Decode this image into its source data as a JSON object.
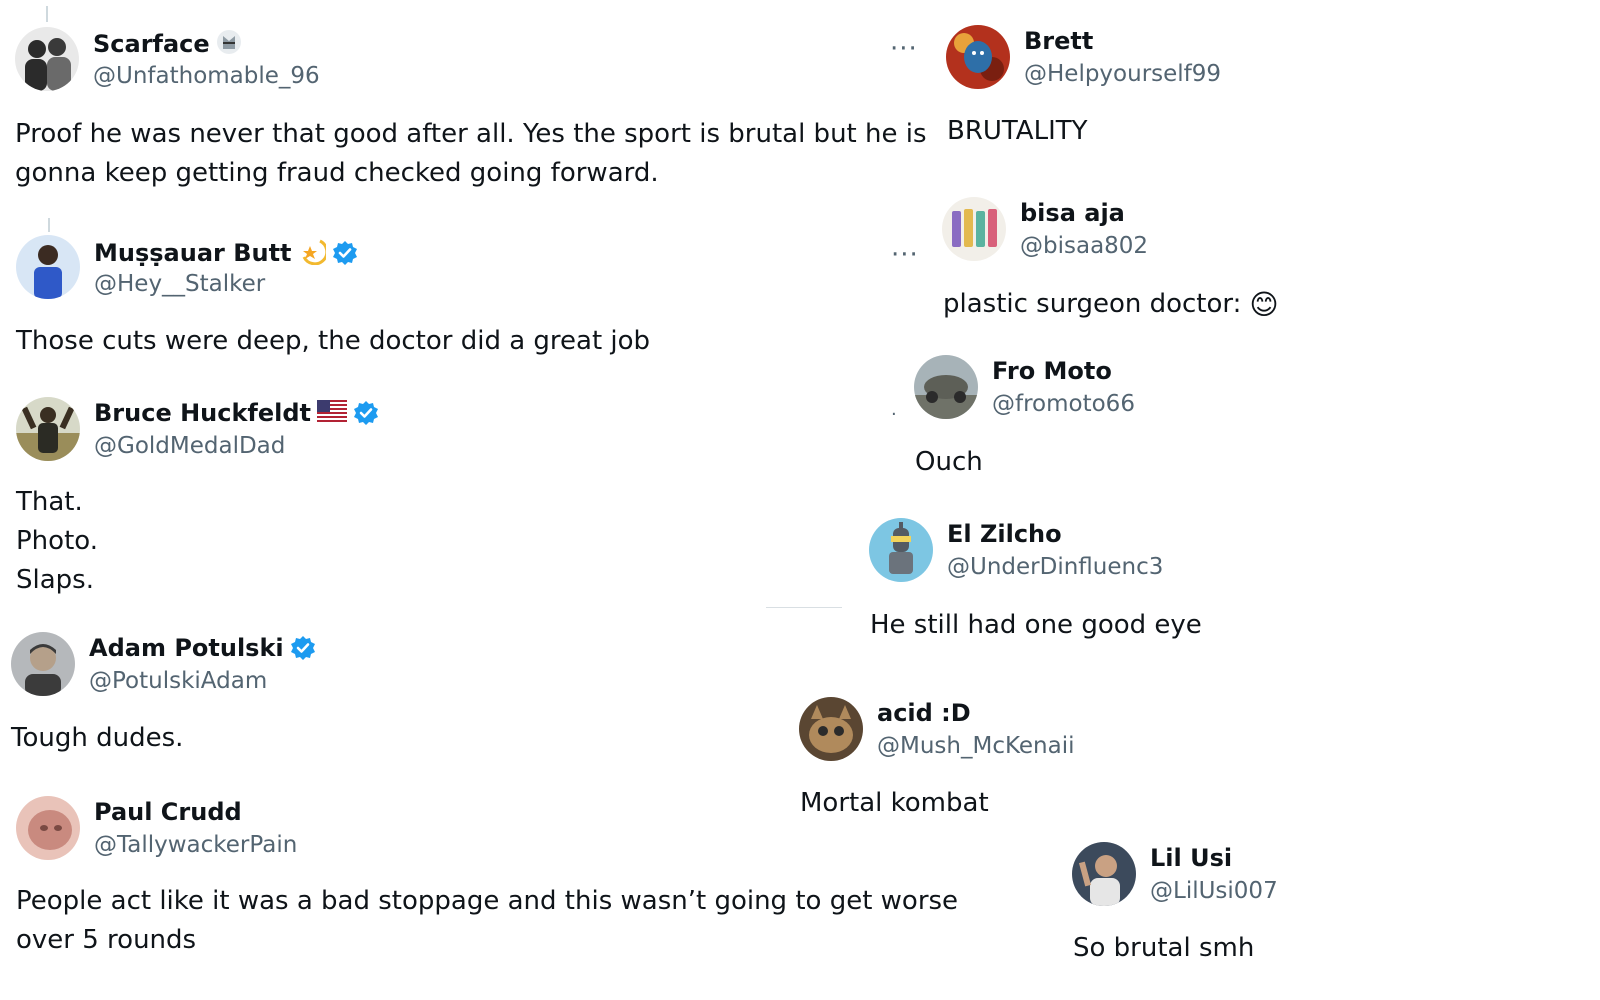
{
  "replies_left": [
    {
      "name": "Scarface",
      "handle": "@Unfathomable_96",
      "lines": [
        "Proof he was never that good after all. Yes the sport is brutal but he is",
        "gonna keep getting fraud checked going forward."
      ],
      "avatar_colors": [
        "#2b2b2b",
        "#6a6a6a"
      ]
    },
    {
      "name": "Muṣṣauar Butt",
      "handle": "@Hey__Stalker",
      "lines": [
        "Those cuts were deep, the doctor did a great job"
      ],
      "avatar_colors": [
        "#2f59c8",
        "#d8e6f5"
      ]
    },
    {
      "name": "Bruce Huckfeldt",
      "handle": "@GoldMedalDad",
      "lines": [
        "That.",
        "Photo.",
        "Slaps."
      ],
      "avatar_colors": [
        "#9a8d5a",
        "#e3e3d8"
      ]
    },
    {
      "name": "Adam Potulski",
      "handle": "@PotulskiAdam",
      "lines": [
        "Tough dudes."
      ],
      "avatar_colors": [
        "#3b3b3b",
        "#b5a08a"
      ]
    },
    {
      "name": "Paul Crudd",
      "handle": "@TallywackerPain",
      "lines": [
        "People act like it was a bad stoppage and this wasn’t going to get worse",
        "over 5 rounds"
      ],
      "avatar_colors": [
        "#c98a7f",
        "#e9c3b9"
      ]
    }
  ],
  "replies_right": [
    {
      "name": "Brett",
      "handle": "@Helpyourself99",
      "lines": [
        "BRUTALITY"
      ],
      "avatar_colors": [
        "#b3311d",
        "#2e6fa8"
      ]
    },
    {
      "name": "bisa aja",
      "handle": "@bisaa802",
      "lines": [
        "plastic surgeon doctor:"
      ],
      "emoji": "😊",
      "avatar_colors": [
        "#e3b94f",
        "#8a6cc2"
      ]
    },
    {
      "name": "Fro Moto",
      "handle": "@fromoto66",
      "lines": [
        "Ouch"
      ],
      "avatar_colors": [
        "#6f7268",
        "#a7b3b8"
      ]
    },
    {
      "name": "El Zilcho",
      "handle": "@UnderDinfluenc3",
      "lines": [
        "He still had one good eye"
      ],
      "avatar_colors": [
        "#7dc6e3",
        "#545b63"
      ]
    },
    {
      "name": "acid :D",
      "handle": "@Mush_McKenaii",
      "lines": [
        "Mortal kombat"
      ],
      "avatar_colors": [
        "#5a4632",
        "#b08a5c"
      ]
    },
    {
      "name": "Lil Usi",
      "handle": "@LilUsi007",
      "lines": [
        "So brutal smh"
      ],
      "avatar_colors": [
        "#3c4a5c",
        "#c9a183"
      ]
    }
  ],
  "ui": {
    "more_glyph": "···",
    "verified_color": "#1d9bf0",
    "handle_color": "#536471"
  }
}
